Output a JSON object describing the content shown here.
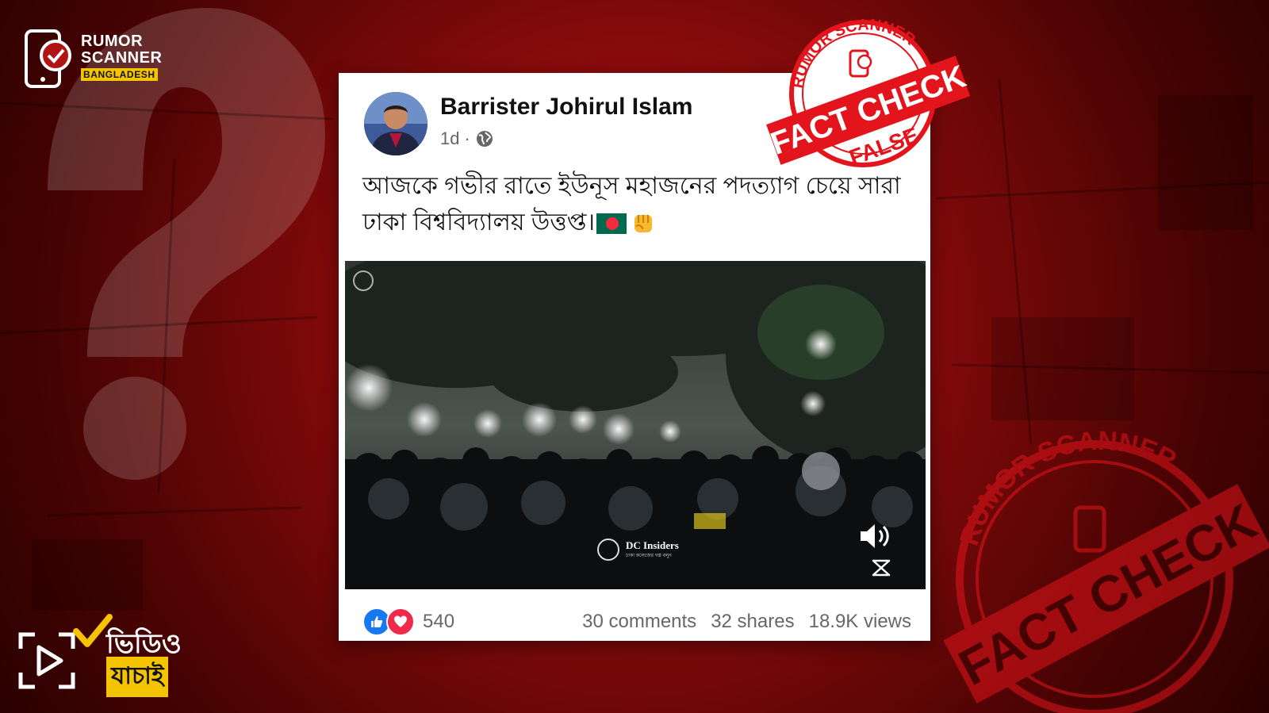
{
  "brand": {
    "line1": "RUMOR",
    "line2": "SCANNER",
    "tag": "BANGLADESH"
  },
  "video_badge": {
    "line1": "ভিডিও",
    "line2": "যাচাই"
  },
  "post": {
    "author": "Barrister Johirul Islam",
    "time": "1d",
    "separator": "·",
    "text": "আজকে গভীর রাতে ইউনূস মহাজনের পদত্যাগ চেয়ে সারা ঢাকা বিশ্ববিদ্যালয় উত্তপ্ত।",
    "watermark_title": "DC Insiders",
    "watermark_sub": "ঢাকা কলেজের গল্প বলুন"
  },
  "footer": {
    "reactions": "540",
    "comments": "30 comments",
    "shares": "32 shares",
    "views": "18.9K views"
  },
  "stamp_top": {
    "arc": "RUMOR SCANNER",
    "banner": "FACT CHECK",
    "verdict": "FALSE"
  },
  "stamp_bottom": {
    "arc": "RUMOR SCANNER",
    "banner": "FACT CHECK"
  },
  "colors": {
    "accent_yellow": "#f5c400",
    "stamp_red": "#e3141b",
    "fb_blue": "#1877f2"
  },
  "icons": [
    "globe-icon",
    "like-icon",
    "love-icon",
    "volume-icon",
    "expand-icon",
    "play-icon",
    "check-icon",
    "phone-check-icon",
    "flag-bangladesh-icon",
    "raised-fist-icon"
  ]
}
